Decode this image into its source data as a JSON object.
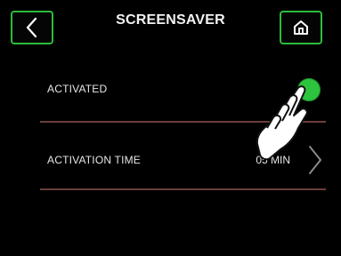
{
  "header": {
    "title": "SCREENSAVER",
    "back_icon": "chevron-left-icon",
    "home_icon": "home-icon"
  },
  "settings": {
    "activated": {
      "label": "ACTIVATED",
      "state": "on",
      "toggle_color": "#2cc43d"
    },
    "activation_time": {
      "label": "ACTIVATION TIME",
      "value": "05 MIN",
      "icon": "chevron-right-icon"
    }
  },
  "colors": {
    "accent": "#2dbb3e",
    "background": "#000000",
    "divider": "#6a3f3a"
  },
  "overlay": {
    "icon": "pointing-hand-icon"
  }
}
